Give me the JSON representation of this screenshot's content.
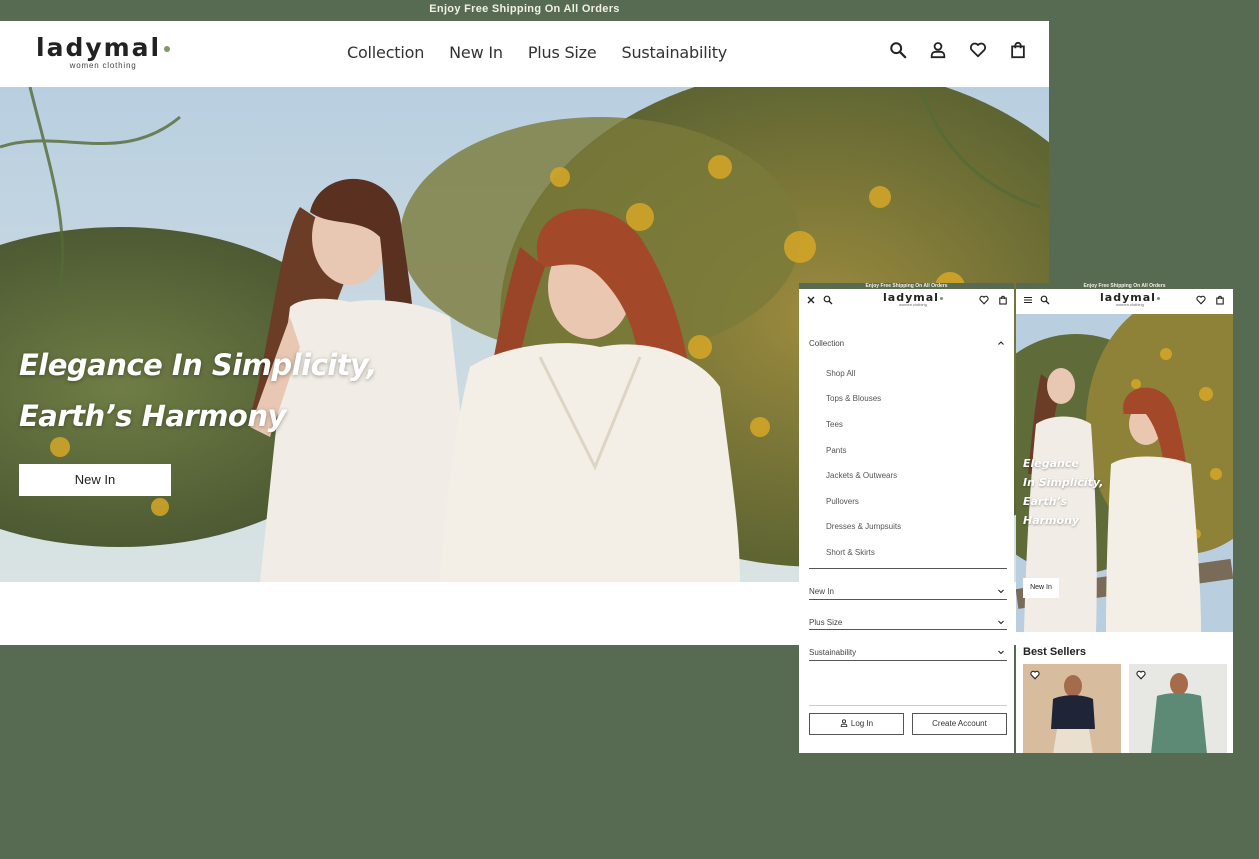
{
  "announcement": "Enjoy Free Shipping On All Orders",
  "brand": {
    "name": "ladymal",
    "tagline": "women clothing"
  },
  "nav": [
    "Collection",
    "New In",
    "Plus Size",
    "Sustainability"
  ],
  "icons": [
    "search-icon",
    "account-icon",
    "heart-icon",
    "bag-icon"
  ],
  "hero": {
    "line1": "Elegance In Simplicity,",
    "line2": "Earth’s Harmony",
    "button": "New In"
  },
  "mobile_menu": {
    "sections": [
      {
        "label": "Collection",
        "expanded": true,
        "items": [
          "Shop All",
          "Tops & Blouses",
          "Tees",
          "Pants",
          "Jackets & Outwears",
          "Pullovers",
          "Dresses & Jumpsuits",
          "Short & Skirts"
        ]
      },
      {
        "label": "New In",
        "expanded": false
      },
      {
        "label": "Plus Size",
        "expanded": false
      },
      {
        "label": "Sustainability",
        "expanded": false
      }
    ],
    "login": "Log In",
    "create_account": "Create Account"
  },
  "mobile_home": {
    "hero_lines": [
      "Elegance",
      "In Simplicity,",
      "Earth’s",
      "Harmony"
    ],
    "button": "New In",
    "best_sellers": "Best Sellers"
  },
  "colors": {
    "brand_green": "#566b51",
    "accent_dot": "#7a9a6c",
    "text": "#222222"
  }
}
